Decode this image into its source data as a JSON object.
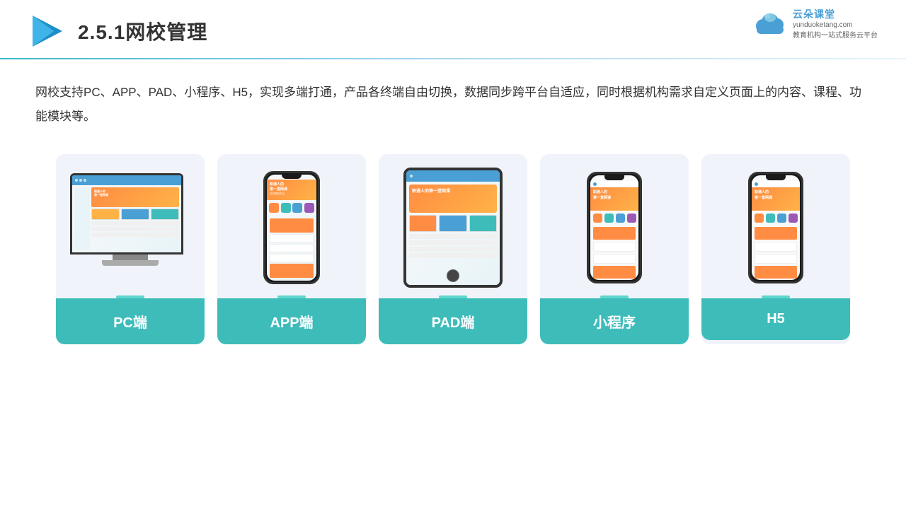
{
  "header": {
    "title": "2.5.1网校管理",
    "title_num": "2.5.1",
    "title_cn": "网校管理"
  },
  "brand": {
    "name": "云朵课堂",
    "domain": "yunduoketang.com",
    "tagline": "教育机构一站\n式服务云平台"
  },
  "description": {
    "text": "网校支持PC、APP、PAD、小程序、H5，实现多端打通，产品各终端自由切换，数据同步跨平台自适应，同时根据机构需求自定义页面上的内容、课程、功能模块等。"
  },
  "cards": [
    {
      "id": "pc",
      "label": "PC端",
      "type": "pc"
    },
    {
      "id": "app",
      "label": "APP端",
      "type": "phone"
    },
    {
      "id": "pad",
      "label": "PAD端",
      "type": "pad"
    },
    {
      "id": "miniapp",
      "label": "小程序",
      "type": "mini-phone"
    },
    {
      "id": "h5",
      "label": "H5",
      "type": "mini-phone"
    }
  ]
}
